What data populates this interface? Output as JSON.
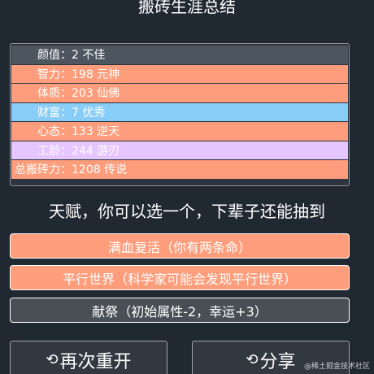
{
  "page_title": "搬砖生涯总结",
  "stats": [
    {
      "name": "颜值：",
      "value": "2 不佳",
      "color": "#4d5561"
    },
    {
      "name": "智力：",
      "value": "198 元神",
      "color": "#fd9d7b"
    },
    {
      "name": "体质：",
      "value": "203 仙佛",
      "color": "#fd9d7b"
    },
    {
      "name": "财富：",
      "value": "7 优秀",
      "color": "#88cdf8"
    },
    {
      "name": "心态：",
      "value": "133 逆天",
      "color": "#fd9d7b"
    },
    {
      "name": "工龄：",
      "value": "244 游刃",
      "color": "#e6c6ff"
    },
    {
      "name": "总搬砖力：",
      "value": "1208 传说",
      "color": "#fd9d7b"
    }
  ],
  "talent_heading": "天赋，你可以选一个，下辈子还能抽到",
  "talents": [
    {
      "label": "满血复活（你有两条命）",
      "color": "#fd9d7b"
    },
    {
      "label": "平行世界（科学家可能会发现平行世界）",
      "color": "#fd9d7b"
    },
    {
      "label": "献祭（初始属性-2，幸运+3）",
      "color": "#4a4f56"
    }
  ],
  "buttons": {
    "restart_label": "再次重开",
    "share_label": "分享",
    "restart_icon": "refresh-icon",
    "share_icon": "refresh-icon"
  },
  "watermark": "@稀土掘金技术社区"
}
